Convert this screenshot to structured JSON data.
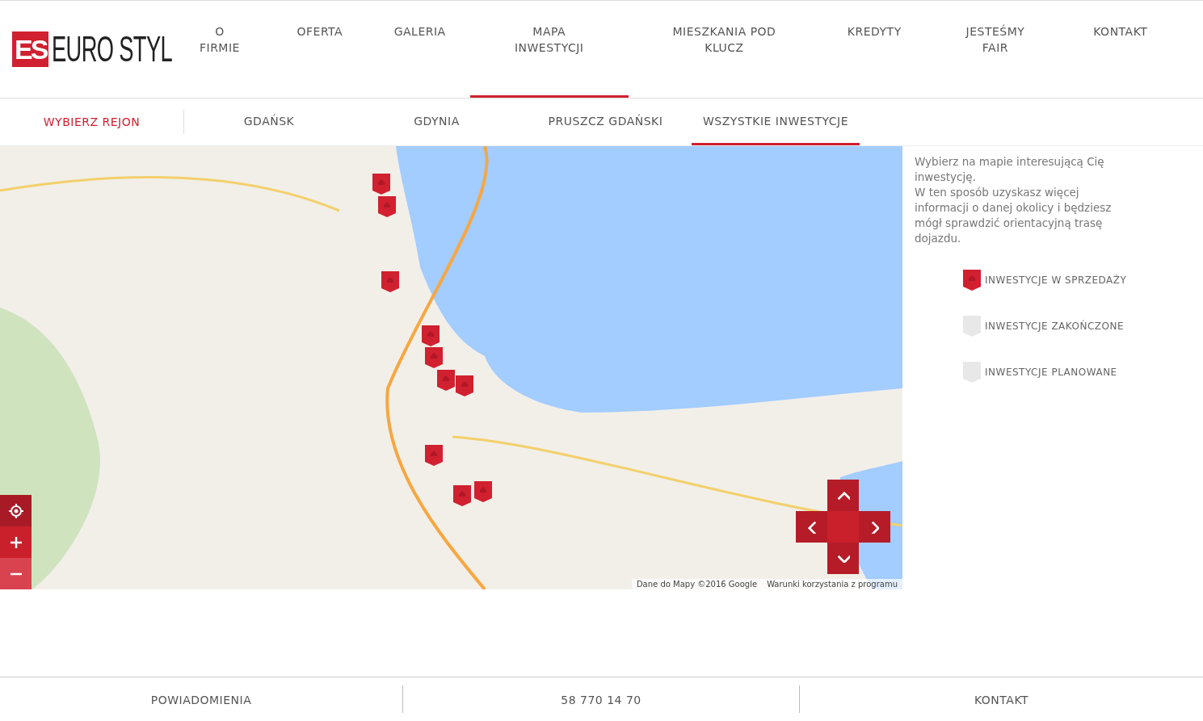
{
  "logo": {
    "mark": "ES",
    "name": "EURO STYL"
  },
  "nav": [
    {
      "label": "O FIRMIE",
      "selected": false
    },
    {
      "label": "OFERTA",
      "selected": false
    },
    {
      "label": "GALERIA",
      "selected": false
    },
    {
      "label": "MAPA INWESTYCJI",
      "selected": true
    },
    {
      "label": "MIESZKANIA POD KLUCZ",
      "selected": false
    },
    {
      "label": "KREDYTY",
      "selected": false
    },
    {
      "label": "JESTEŚMY FAIR",
      "selected": false
    },
    {
      "label": "KONTAKT",
      "selected": false
    }
  ],
  "region_bar": {
    "title": "WYBIERZ REJON",
    "tabs": [
      {
        "label": "GDAŃSK",
        "selected": false
      },
      {
        "label": "GDYNIA",
        "selected": false
      },
      {
        "label": "PRUSZCZ GDAŃSKI",
        "selected": false
      },
      {
        "label": "WSZYSTKIE INWESTYCJE",
        "selected": true
      }
    ]
  },
  "map": {
    "markers": [
      {
        "kind": "sale"
      },
      {
        "kind": "sale"
      },
      {
        "kind": "sale"
      },
      {
        "kind": "sale"
      },
      {
        "kind": "sale"
      },
      {
        "kind": "sale"
      },
      {
        "kind": "sale"
      },
      {
        "kind": "sale"
      },
      {
        "kind": "sale"
      },
      {
        "kind": "sale"
      }
    ],
    "attribution": "Dane do Mapy ©2016 Google",
    "terms": "Warunki korzystania z programu"
  },
  "info": {
    "intro": "Wybierz na mapie interesującą Cię inwestycję.",
    "details": "W ten sposób uzyskasz więcej informacji o danej okolicy i będziesz mógł sprawdzić orientacyjną trasę dojazdu."
  },
  "legend": [
    {
      "kind": "sale",
      "label": "INWESTYCJE W SPRZEDAŻY"
    },
    {
      "kind": "completed",
      "label": "INWESTYCJE ZAKOŃCZONE"
    },
    {
      "kind": "planned",
      "label": "INWESTYCJE PLANOWANE"
    }
  ],
  "footer": [
    "POWIADOMIENIA",
    "58 770 14 70",
    "KONTAKT"
  ]
}
